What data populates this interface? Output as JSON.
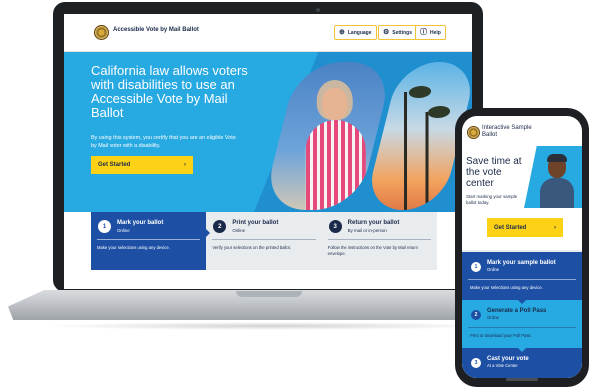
{
  "laptop": {
    "header": {
      "site_title": "Accessible Vote by Mail Ballot",
      "language_label": "Language",
      "settings_label": "Settings",
      "help_label": "Help"
    },
    "hero": {
      "title": "California law allows voters with disabilities to use an Accessible Vote by Mail Ballot",
      "subtitle": "By using this system, you certify that you are an eligible Vote by Mail voter with a disability.",
      "cta_label": "Get Started",
      "cta_arrow": "›"
    },
    "steps": [
      {
        "number": "1",
        "title": "Mark your ballot",
        "subtitle": "Online",
        "description": "Make your selections using any device."
      },
      {
        "number": "2",
        "title": "Print your ballot",
        "subtitle": "Online",
        "description": "Verify your selections on the printed ballot."
      },
      {
        "number": "3",
        "title": "Return your ballot",
        "subtitle": "By mail or in-person",
        "description": "Follow the instructions on the Vote by Mail return envelope."
      }
    ]
  },
  "phone": {
    "brand": "Interactive Sample Ballot",
    "hero": {
      "title": "Save time at the vote center",
      "subtitle": "Start marking your sample ballot today.",
      "cta_label": "Get Started",
      "cta_arrow": "›"
    },
    "steps": [
      {
        "number": "1",
        "title": "Mark your sample ballot",
        "subtitle": "Online",
        "description": "Make your selections using any device."
      },
      {
        "number": "2",
        "title": "Generate a Poll Pass",
        "subtitle": "Online",
        "description": "Print or download your Poll Pass."
      },
      {
        "number": "3",
        "title": "Cast your vote",
        "subtitle": "At a Vote Center"
      }
    ]
  },
  "colors": {
    "primary_blue": "#1d4fa5",
    "sky_blue": "#27a9e1",
    "cta_yellow": "#fcd116",
    "navy_text": "#1b2a4a"
  },
  "icons": {
    "language": "globe-icon",
    "settings": "gear-icon",
    "help": "help-circle-icon",
    "seal": "state-seal"
  }
}
